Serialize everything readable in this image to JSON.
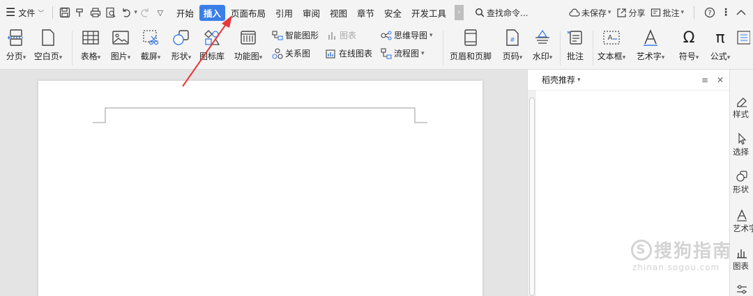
{
  "menubar": {
    "file_label": "文件",
    "tabs": [
      {
        "label": "开始",
        "active": false
      },
      {
        "label": "插入",
        "active": true
      },
      {
        "label": "页面布局",
        "active": false
      },
      {
        "label": "引用",
        "active": false
      },
      {
        "label": "审阅",
        "active": false
      },
      {
        "label": "视图",
        "active": false
      },
      {
        "label": "章节",
        "active": false
      },
      {
        "label": "安全",
        "active": false
      },
      {
        "label": "开发工具",
        "active": false
      }
    ],
    "search_label": "查找命令...",
    "unsaved_label": "未保存",
    "share_label": "分享",
    "comment_label": "批注"
  },
  "ribbon": {
    "page_break": "分页",
    "blank_page": "空白页",
    "table": "表格",
    "picture": "图片",
    "screenshot": "截屏",
    "shape": "形状",
    "icon_lib": "图标库",
    "function_chart": "功能图",
    "smart_art": "智能图形",
    "chart": "图表",
    "relation_chart": "关系图",
    "online_chart": "在线图表",
    "mind_map": "思维导图",
    "flow_chart": "流程图",
    "header_footer": "页眉和页脚",
    "page_number": "页码",
    "watermark": "水印",
    "comment": "批注",
    "textbox": "文本框",
    "wordart": "艺术字",
    "symbol": "符号",
    "formula": "公式"
  },
  "pane": {
    "title": "稻壳推荐"
  },
  "sidebar": {
    "items": [
      "样式",
      "选择",
      "形状",
      "艺术字",
      "图表"
    ]
  },
  "watermark": {
    "main": "搜狗指南",
    "s_letter": "S",
    "sub": "zhinan.sogou.com"
  },
  "colors": {
    "accent": "#3a7ee8",
    "arrow": "#e8373a"
  }
}
